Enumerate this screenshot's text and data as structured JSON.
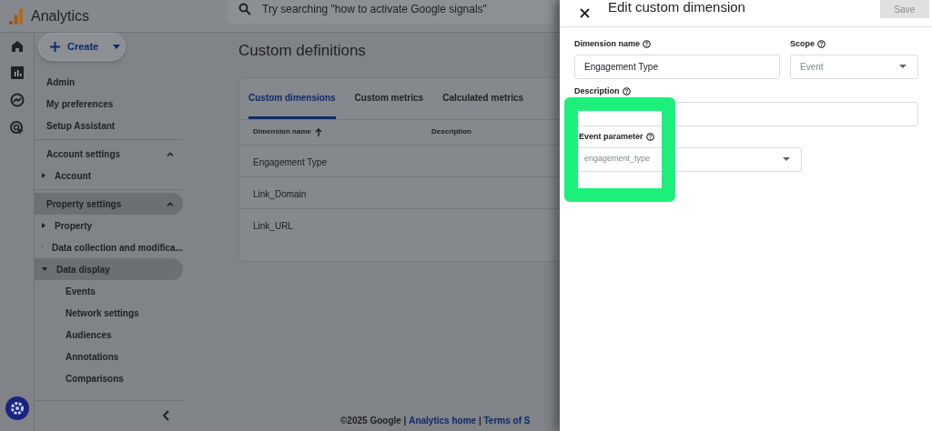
{
  "app": {
    "title": "Analytics"
  },
  "search": {
    "placeholder": "Try searching \"how to activate Google signals\""
  },
  "create_button": {
    "label": "Create"
  },
  "sidebar": {
    "top_items": [
      {
        "label": "Admin"
      },
      {
        "label": "My preferences"
      },
      {
        "label": "Setup Assistant"
      }
    ],
    "sections": [
      {
        "label": "Account settings",
        "expanded": true,
        "selected": false,
        "items": [
          {
            "label": "Account",
            "expanded": false,
            "selected": false
          }
        ]
      },
      {
        "label": "Property settings",
        "expanded": true,
        "selected": true,
        "items": [
          {
            "label": "Property",
            "expanded": false,
            "selected": false
          },
          {
            "label": "Data collection and modifica...",
            "expanded": false,
            "selected": false
          },
          {
            "label": "Data display",
            "expanded": true,
            "selected": true,
            "children": [
              {
                "label": "Events"
              },
              {
                "label": "Network settings"
              },
              {
                "label": "Audiences"
              },
              {
                "label": "Annotations"
              },
              {
                "label": "Comparisons"
              }
            ]
          }
        ]
      }
    ]
  },
  "page_title": "Custom definitions",
  "tabs": [
    {
      "label": "Custom dimensions",
      "selected": true
    },
    {
      "label": "Custom metrics",
      "selected": false
    },
    {
      "label": "Calculated metrics",
      "selected": false
    }
  ],
  "table": {
    "columns": [
      "Dimension name",
      "Description"
    ],
    "rows": [
      [
        "Engagement Type",
        ""
      ],
      [
        "Link_Domain",
        ""
      ],
      [
        "Link_URL",
        ""
      ]
    ]
  },
  "footer": [
    {
      "text": "©2025 Google",
      "kind": "plain"
    },
    {
      "text": " | ",
      "kind": "plain"
    },
    {
      "text": "Analytics home",
      "kind": "link"
    },
    {
      "text": " | ",
      "kind": "plain"
    },
    {
      "text": "Terms of S",
      "kind": "link"
    }
  ],
  "drawer": {
    "title": "Edit custom dimension",
    "save_button": {
      "label": "Save",
      "disabled": true
    },
    "fields": [
      {
        "label": "Dimension name",
        "kind": "text",
        "value": "Engagement Type",
        "disabled": false
      },
      {
        "label": "Scope",
        "kind": "select",
        "value": "Event",
        "disabled": true
      },
      {
        "label": "Description",
        "kind": "text"
      },
      {
        "label": "Event parameter",
        "kind": "select",
        "value": "engagement_type",
        "disabled": true
      }
    ]
  }
}
